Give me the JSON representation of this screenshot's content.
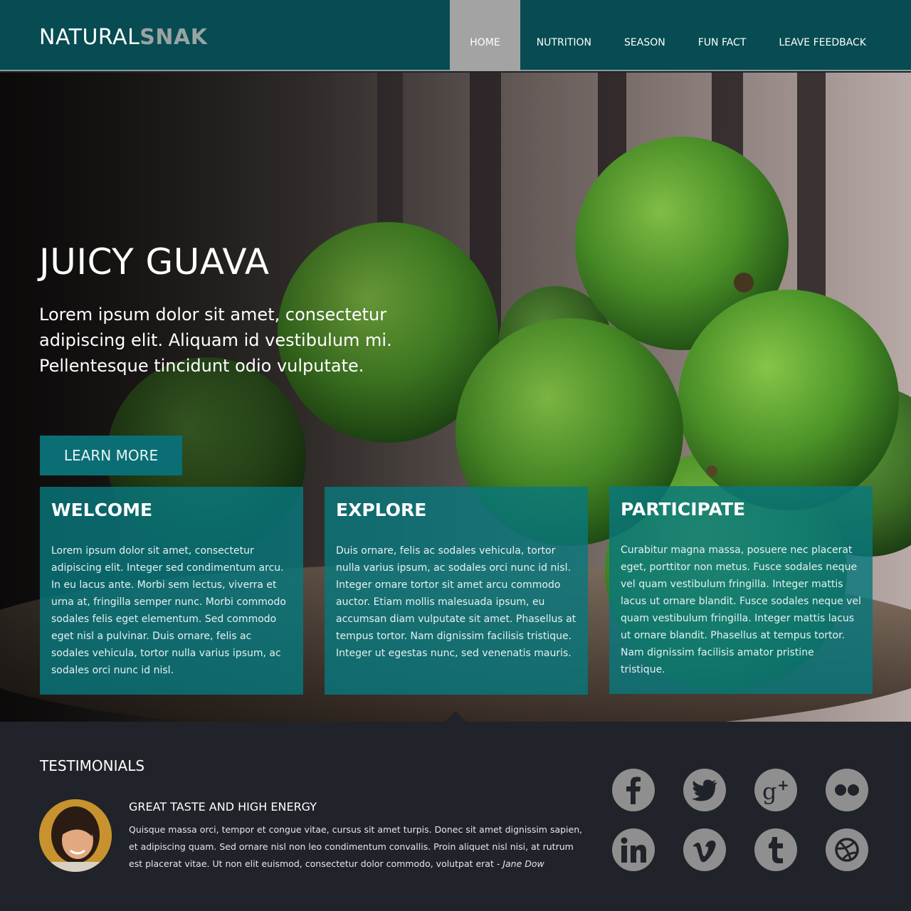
{
  "brand": {
    "name_part1": "NATURAL",
    "name_part2": "SNAK"
  },
  "nav": {
    "items": [
      {
        "label": "HOME"
      },
      {
        "label": "NUTRITION"
      },
      {
        "label": "SEASON"
      },
      {
        "label": "FUN FACT"
      },
      {
        "label": "LEAVE FEEDBACK"
      }
    ],
    "active_label": "HOME"
  },
  "hero": {
    "title": "JUICY GUAVA",
    "text": "Lorem ipsum dolor sit amet, consectetur adipiscing elit. Aliquam id vestibulum mi. Pellentesque tincidunt odio vulputate.",
    "button_label": "LEARN MORE"
  },
  "cards": [
    {
      "title": "WELCOME",
      "body": "Lorem ipsum dolor sit amet, consectetur adipiscing elit. Integer sed condimentum arcu. In eu lacus ante. Morbi sem lectus, viverra et urna at, fringilla semper nunc. Morbi commodo sodales felis eget elementum. Sed commodo eget nisl a pulvinar. Duis ornare, felis ac sodales vehicula, tortor nulla varius ipsum, ac sodales orci nunc id nisl."
    },
    {
      "title": "EXPLORE",
      "body": "Duis ornare, felis ac sodales vehicula, tortor nulla varius ipsum, ac sodales orci nunc id nisl. Integer ornare tortor sit amet arcu commodo auctor. Etiam mollis malesuada ipsum, eu accumsan diam vulputate sit amet. Phasellus at tempus tortor. Nam dignissim facilisis tristique. Integer ut egestas nunc, sed venenatis mauris."
    },
    {
      "title": "PARTICIPATE",
      "body": "Curabitur magna massa, posuere nec placerat eget, porttitor non metus. Fusce sodales neque vel quam vestibulum fringilla. Integer mattis lacus ut ornare blandit. Fusce sodales neque vel quam vestibulum fringilla. Integer mattis lacus ut ornare blandit. Phasellus at tempus tortor. Nam dignissim facilisis amator pristine tristique."
    }
  ],
  "testimonials": {
    "heading": "TESTIMONIALS",
    "quote_title": "GREAT TASTE AND HIGH ENERGY",
    "quote_body": "Quisque massa orci, tempor et congue vitae, cursus sit amet turpis. Donec sit amet dignissim sapien, et adipiscing quam. Sed ornare nisl non leo condimentum convallis. Proin aliquet nisl nisi, at rutrum est placerat vitae. Ut non elit euismod, consectetur dolor commodo, volutpat erat - ",
    "author": "Jane Dow"
  },
  "social": {
    "icons": [
      "facebook-icon",
      "twitter-icon",
      "google-plus-icon",
      "flickr-icon",
      "linkedin-icon",
      "vimeo-icon",
      "tumblr-icon",
      "dribbble-icon"
    ]
  },
  "colors": {
    "header_bg": "#064c52",
    "nav_active_bg": "#a3a3a3",
    "accent": "#0b6e74",
    "footer_bg": "#202329",
    "social_icon": "#8f8f8f"
  }
}
